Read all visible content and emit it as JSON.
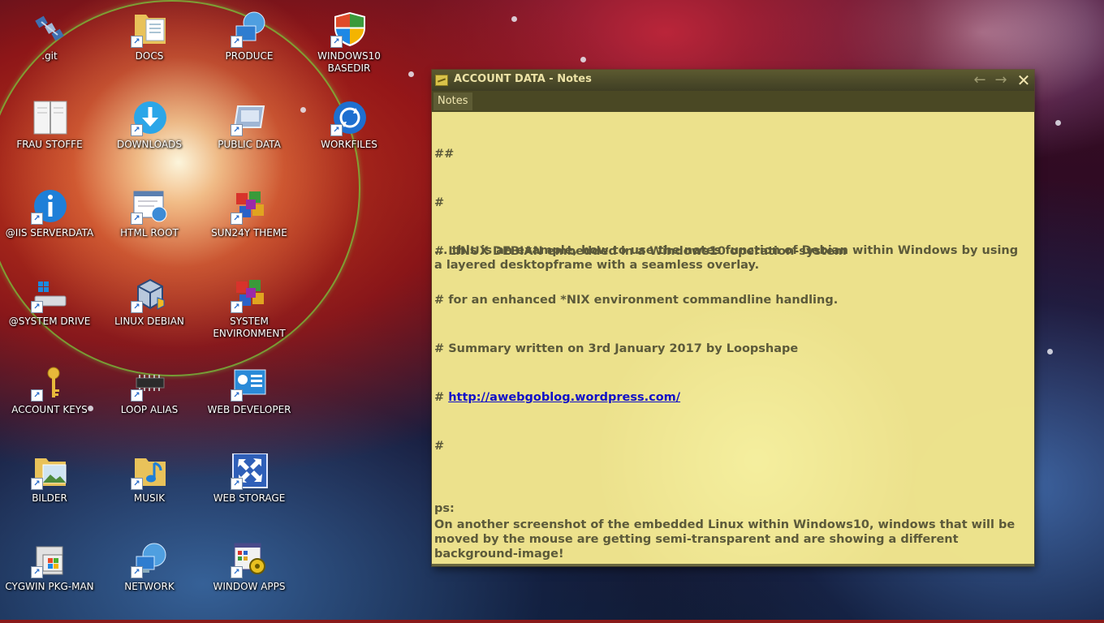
{
  "desktop": {
    "icons": [
      {
        "label": ".git",
        "icon": "satellite-icon"
      },
      {
        "label": "DOCS",
        "icon": "folder-documents-icon"
      },
      {
        "label": "PRODUCE",
        "icon": "globe-monitor-icon"
      },
      {
        "label": "WINDOWS10\nBASEDIR",
        "icon": "windows-shield-icon"
      },
      {
        "label": "FRAU STOFFE",
        "icon": "book-icon"
      },
      {
        "label": "DOWNLOADS",
        "icon": "download-icon"
      },
      {
        "label": "PUBLIC DATA",
        "icon": "monitor-window-icon"
      },
      {
        "label": "WORKFILES",
        "icon": "sync-icon"
      },
      {
        "label": "@IIS SERVERDATA",
        "icon": "info-icon"
      },
      {
        "label": "HTML ROOT",
        "icon": "web-page-icon"
      },
      {
        "label": "SUN24Y THEME",
        "icon": "cubes-icon"
      },
      {
        "label": "@SYSTEM DRIVE",
        "icon": "windows-drive-icon"
      },
      {
        "label": "LINUX DEBIAN",
        "icon": "virtualbox-icon"
      },
      {
        "label": "SYSTEM\nENVIRONMENT",
        "icon": "cubes-icon"
      },
      {
        "label": "ACCOUNT KEYS",
        "icon": "key-icon"
      },
      {
        "label": "LOOP ALIAS",
        "icon": "chip-icon"
      },
      {
        "label": "WEB DEVELOPER",
        "icon": "control-panel-icon"
      },
      {
        "label": "BILDER",
        "icon": "folder-pictures-icon"
      },
      {
        "label": "MUSIK",
        "icon": "folder-music-icon"
      },
      {
        "label": "WEB STORAGE",
        "icon": "expand-arrows-icon"
      },
      {
        "label": "CYGWIN PKG-MAN",
        "icon": "setup-icon"
      },
      {
        "label": "NETWORK",
        "icon": "network-globe-icon"
      },
      {
        "label": "WINDOW APPS",
        "icon": "app-gear-icon"
      }
    ]
  },
  "notes_window": {
    "title": "ACCOUNT DATA - Notes",
    "nav_back": "←",
    "nav_forward": "→",
    "close": "✕",
    "tab_label": "Notes",
    "lines": [
      "##",
      "#",
      "# LINUX DEBIAN embedded in a Windows10 operation-system",
      "# for an enhanced *NIX environment commandline handling.",
      "# Summary written on 3rd January 2017 by Loopshape"
    ],
    "link_prefix": "# ",
    "link_text": "http://awebgoblog.wordpress.com/",
    "line_after_link": "#",
    "paragraph1": "... this is an example, how to use the notes function of Debian within Windows by using a layered desktopframe with a seamless overlay.",
    "ps_label": "ps:",
    "paragraph2": "On another screenshot of the embedded Linux within Windows10, windows that will be moved by the mouse are getting semi-transparent and are showing a different background-image!"
  },
  "colors": {
    "notes_background": "#ece18c",
    "notes_text": "#5c5a3a",
    "link": "#1010c8",
    "titlebar": "#4a4824"
  }
}
